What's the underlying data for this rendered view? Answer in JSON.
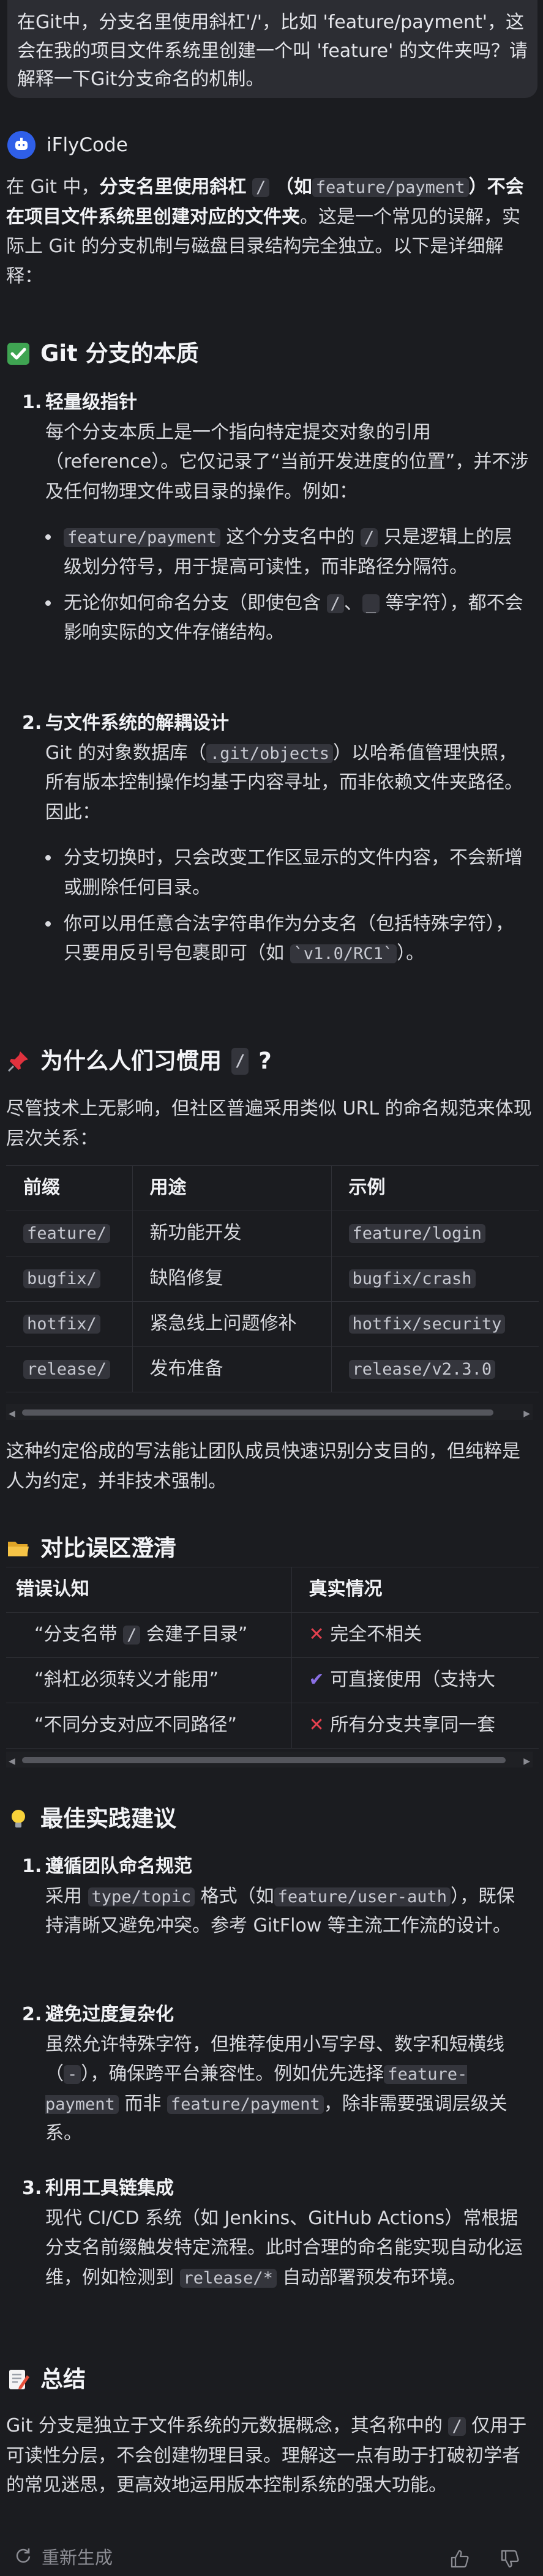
{
  "user_message": "在Git中，分支名里使用斜杠'/'，比如 'feature/payment'，这会在我的项目文件系统里创建一个叫 'feature' 的文件夹吗？请解释一下Git分支命名的机制。",
  "assistant": {
    "name": "iFlyCode"
  },
  "intro": {
    "p1": "在 Git 中，",
    "b1": "分支名里使用斜杠",
    "code1": "/",
    "b2": "（如",
    "code2": "feature/payment",
    "b3": "）不会在项目文件系统里创建对应的文件夹",
    "p2": "。这是一个常见的误解，实际上 Git 的分支机制与磁盘目录结构完全独立。以下是详细解释："
  },
  "section1": {
    "title": "Git 分支的本质",
    "items": [
      {
        "num": "1.",
        "title": "轻量级指针",
        "desc": "每个分支本质上是一个指向特定提交对象的引用（reference）。它仅记录了“当前开发进度的位置”，并不涉及任何物理文件或目录的操作。例如：",
        "bullets": [
          {
            "code": "feature/payment",
            "mid": "这个分支名中的",
            "code2": "/",
            "text": "只是逻辑上的层级划分符号，用于提高可读性，而非路径分隔符。"
          },
          {
            "text_a": "无论你如何命名分支（即使包含",
            "code": "/",
            "sep": "、",
            "code2": "_",
            "text_b": "等字符），都不会影响实际的文件存储结构。"
          }
        ]
      },
      {
        "num": "2.",
        "title": "与文件系统的解耦设计",
        "desc_a": "Git 的对象数据库（",
        "desc_code": ".git/objects",
        "desc_b": "）以哈希值管理快照，所有版本控制操作均基于内容寻址，而非依赖文件夹路径。因此：",
        "bullets": [
          {
            "text": "分支切换时，只会改变工作区显示的文件内容，不会新增或删除任何目录。"
          },
          {
            "text_a": "你可以用任意合法字符串作为分支名（包括特殊字符），只要用反引号包裹即可（如",
            "code": "`v1.0/RC1`",
            "text_b": "）。"
          }
        ]
      }
    ]
  },
  "section2": {
    "title_a": "为什么人们习惯用",
    "title_code": "/",
    "title_b": "?",
    "desc": "尽管技术上无影响，但社区普遍采用类似 URL 的命名规范来体现层次关系：",
    "headers": [
      "前缀",
      "用途",
      "示例"
    ],
    "rows": [
      [
        "feature/",
        "新功能开发",
        "feature/login"
      ],
      [
        "bugfix/",
        "缺陷修复",
        "bugfix/crash"
      ],
      [
        "hotfix/",
        "紧急线上问题修补",
        "hotfix/security"
      ],
      [
        "release/",
        "发布准备",
        "release/v2.3.0"
      ]
    ],
    "note": "这种约定俗成的写法能让团队成员快速识别分支目的，但纯粹是人为约定，并非技术强制。"
  },
  "section3": {
    "title": "对比误区澄清",
    "headers": [
      "错误认知",
      "真实情况"
    ],
    "rows": [
      {
        "a1": "“分支名带",
        "code": "/",
        "a2": "会建子目录”",
        "icon": "cross",
        "b": "完全不相关"
      },
      {
        "a1": "“斜杠必须转义才能用”",
        "icon": "check",
        "b": "可直接使用（支持大"
      },
      {
        "a1": "“不同分支对应不同路径”",
        "icon": "cross",
        "b": "所有分支共享同一套"
      }
    ]
  },
  "section4": {
    "title": "最佳实践建议",
    "items": [
      {
        "num": "1.",
        "title": "遵循团队命名规范",
        "t1": "采用",
        "c1": "type/topic",
        "t2": "格式（如",
        "c2": "feature/user-auth",
        "t3": "），既保持清晰又避免冲突。参考 GitFlow 等主流工作流的设计。"
      },
      {
        "num": "2.",
        "title": "避免过度复杂化",
        "t1": "虽然允许特殊字符，但推荐使用小写字母、数字和短横线（",
        "c1": "-",
        "t2": "），确保跨平台兼容性。例如优先选择",
        "c2": "feature-payment",
        "t3": "而非",
        "c3": "feature/payment",
        "t4": "，除非需要强调层级关系。"
      },
      {
        "num": "3.",
        "title": "利用工具链集成",
        "t1": "现代 CI/CD 系统（如 Jenkins、GitHub Actions）常根据分支名前缀触发特定流程。此时合理的命名能实现自动化运维，例如检测到",
        "c1": "release/*",
        "t2": "自动部署预发布环境。"
      }
    ]
  },
  "section5": {
    "title": "总结",
    "t1": "Git 分支是独立于文件系统的元数据概念，其名称中的",
    "c1": "/",
    "t2": "仅用于可读性分层，不会创建物理目录。理解这一点有助于打破初学者的常见迷思，更高效地运用版本控制系统的强大功能。"
  },
  "footer": {
    "regenerate": "重新生成"
  }
}
